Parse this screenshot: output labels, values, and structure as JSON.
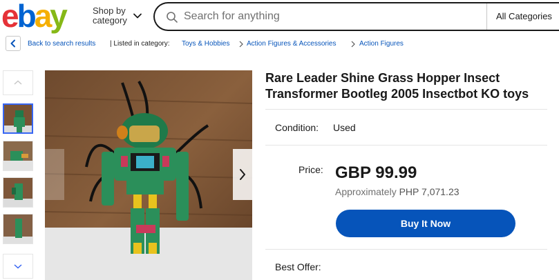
{
  "header": {
    "logo_letters": [
      "e",
      "b",
      "a",
      "y"
    ],
    "logo_colors": [
      "#e53238",
      "#0064d2",
      "#f5af02",
      "#86b817"
    ],
    "shop_by_line1": "Shop by",
    "shop_by_line2": "category",
    "search_placeholder": "Search for anything",
    "category_select": "All Categories"
  },
  "breadcrumb": {
    "back_label": "Back to search results",
    "listed_label": "| Listed in category:",
    "items": [
      "Toys & Hobbies",
      "Action Figures & Accessories",
      "Action Figures"
    ]
  },
  "gallery": {
    "up_icon": "chevron-up-icon",
    "down_icon": "chevron-down-icon",
    "next_icon": "chevron-right-icon",
    "thumbnail_count": 4,
    "selected_index": 0
  },
  "listing": {
    "title": "Rare Leader Shine Grass Hopper Insect Transformer Bootleg 2005 Insectbot KO toys",
    "condition_label": "Condition:",
    "condition_value": "Used",
    "price_label": "Price:",
    "price": "GBP 99.99",
    "approx_prefix": "Approximately",
    "approx_value": "PHP 7,071.23",
    "buy_now_label": "Buy It Now",
    "best_offer_label": "Best Offer:"
  },
  "colors": {
    "accent": "#0654ba",
    "link": "#0654ba",
    "selected_thumb": "#3665f3"
  }
}
